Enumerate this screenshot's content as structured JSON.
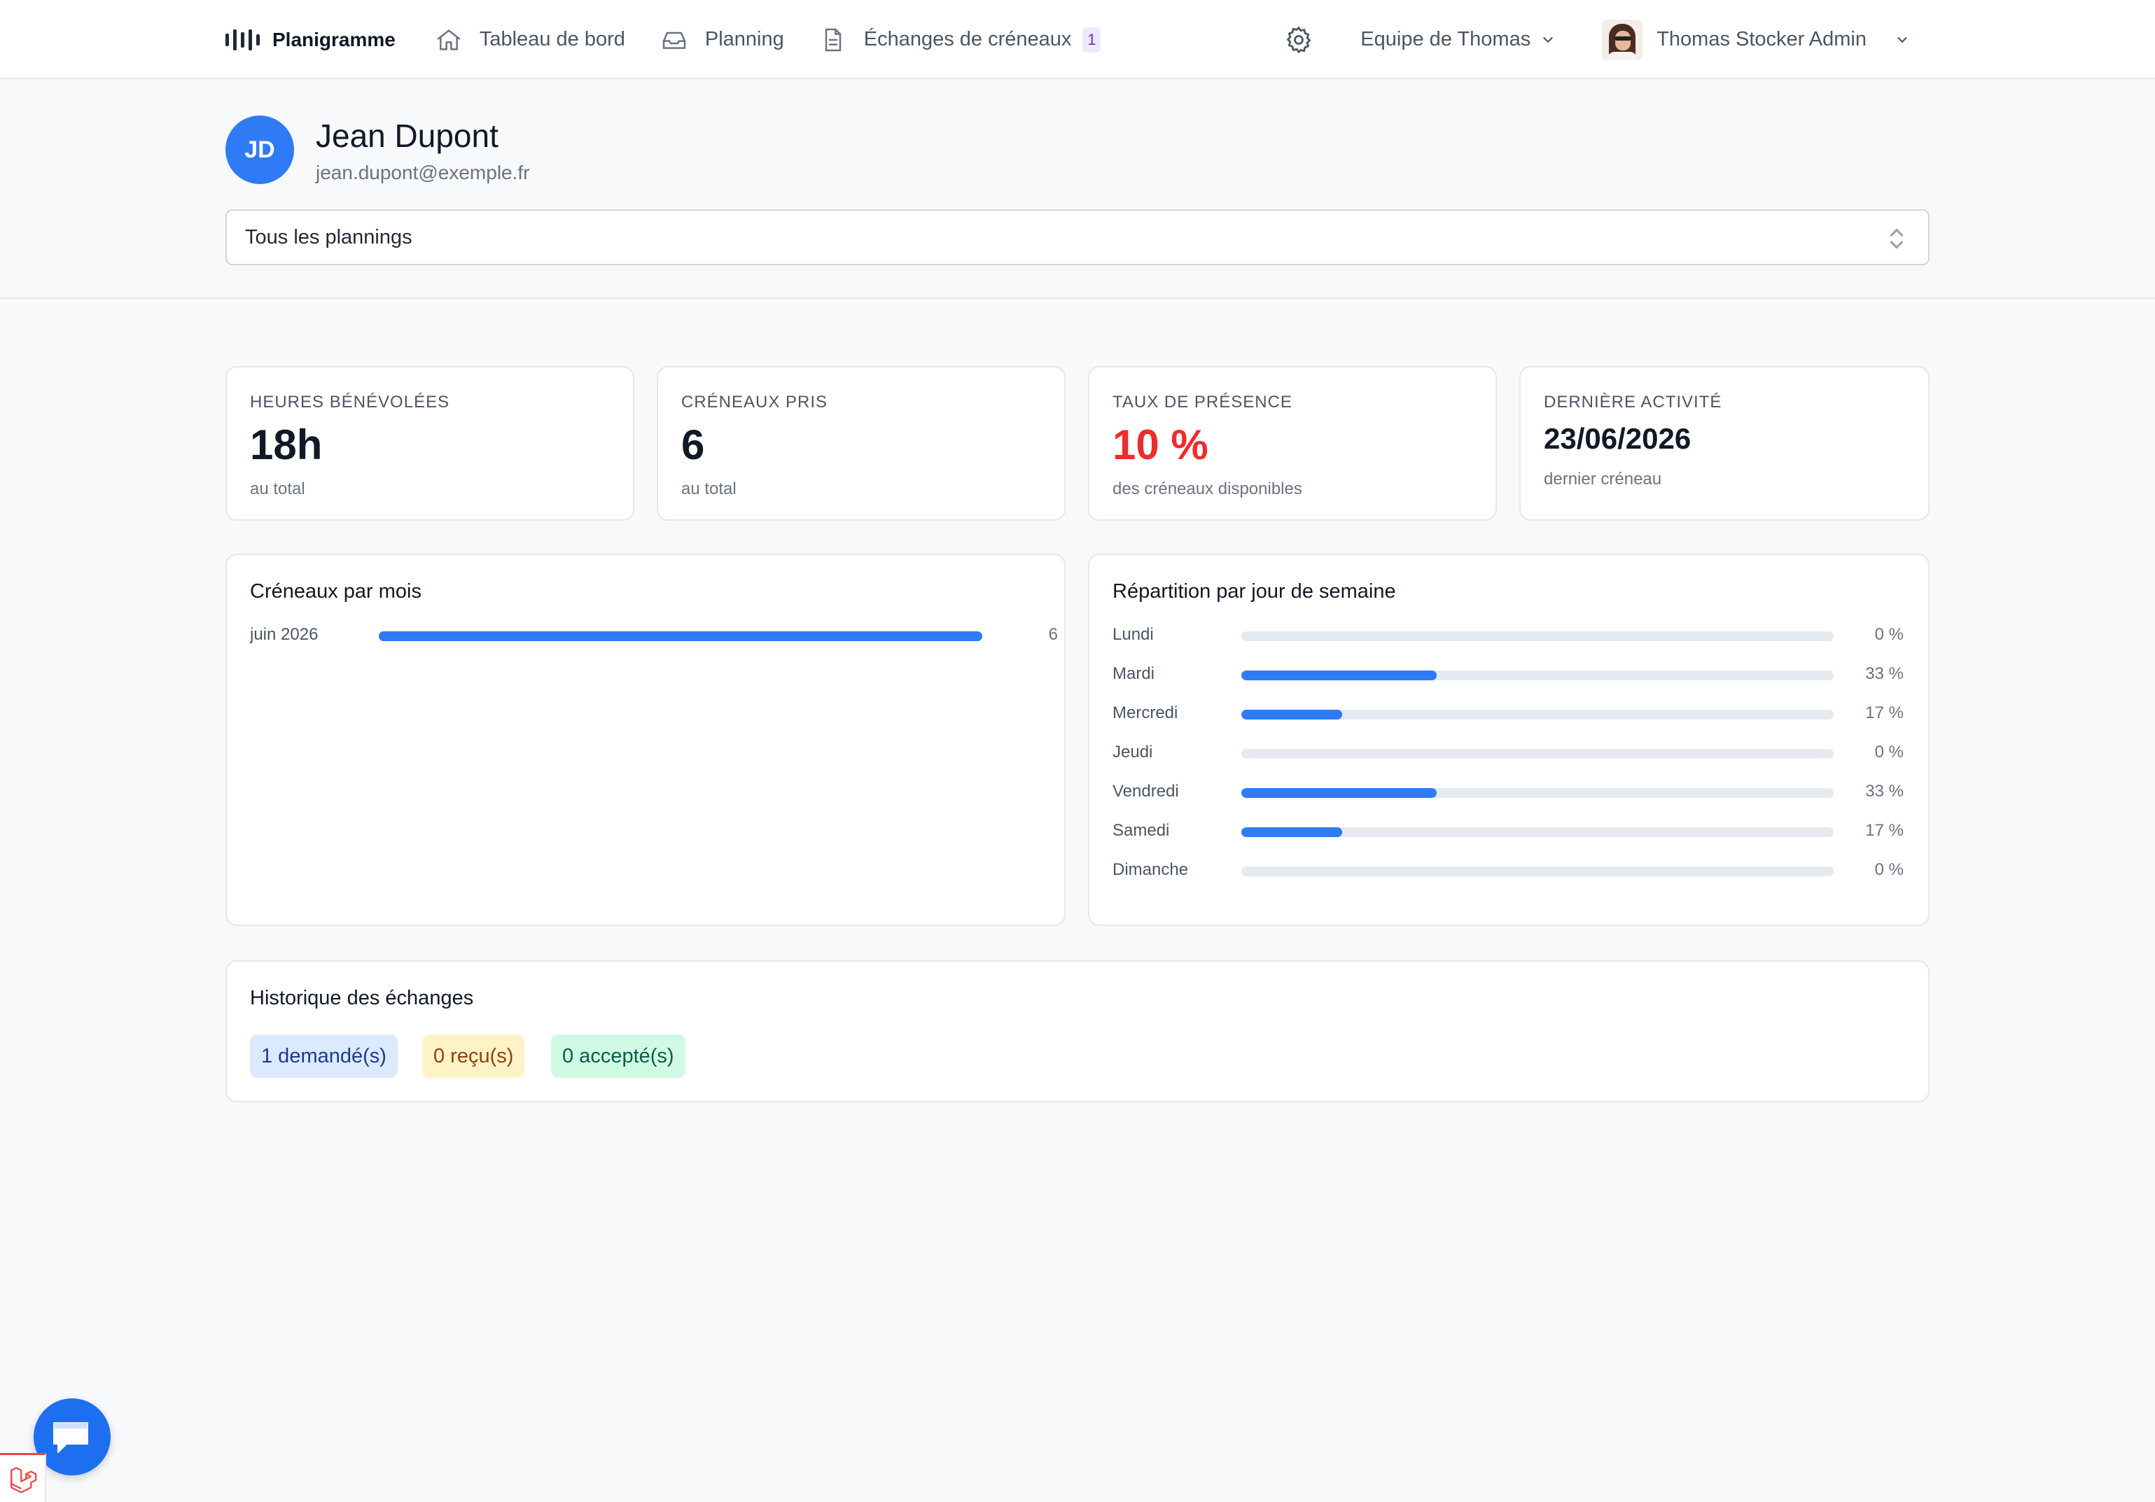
{
  "nav": {
    "brand": "Planigramme",
    "links": [
      {
        "label": "Tableau de bord",
        "icon": "home-icon"
      },
      {
        "label": "Planning",
        "icon": "inbox-icon"
      },
      {
        "label": "Échanges de créneaux",
        "icon": "document-icon",
        "badge": "1"
      }
    ],
    "team": "Equipe de Thomas",
    "user": "Thomas Stocker Admin"
  },
  "profile": {
    "initials": "JD",
    "name": "Jean Dupont",
    "email": "jean.dupont@exemple.fr",
    "planning_select": "Tous les plannings"
  },
  "stats": [
    {
      "label": "HEURES BÉNÉVOLÉES",
      "value": "18h",
      "sub": "au total"
    },
    {
      "label": "CRÉNEAUX PRIS",
      "value": "6",
      "sub": "au total"
    },
    {
      "label": "TAUX DE PRÉSENCE",
      "value": "10 %",
      "sub": "des créneaux disponibles",
      "value_color": "#ef2b2b"
    },
    {
      "label": "DERNIÈRE ACTIVITÉ",
      "value": "23/06/2026",
      "sub": "dernier créneau"
    }
  ],
  "by_month": {
    "title": "Créneaux par mois",
    "rows": [
      {
        "label": "juin 2026",
        "value": "6",
        "fill": 1.0
      }
    ]
  },
  "by_weekday": {
    "title": "Répartition par jour de semaine",
    "rows": [
      {
        "label": "Lundi",
        "value": "0 %",
        "fill": 0.0
      },
      {
        "label": "Mardi",
        "value": "33 %",
        "fill": 0.33
      },
      {
        "label": "Mercredi",
        "value": "17 %",
        "fill": 0.17
      },
      {
        "label": "Jeudi",
        "value": "0 %",
        "fill": 0.0
      },
      {
        "label": "Vendredi",
        "value": "33 %",
        "fill": 0.33
      },
      {
        "label": "Samedi",
        "value": "17 %",
        "fill": 0.17
      },
      {
        "label": "Dimanche",
        "value": "0 %",
        "fill": 0.0
      }
    ]
  },
  "history": {
    "title": "Historique des échanges",
    "requested": "1 demandé(s)",
    "received": "0 reçu(s)",
    "accepted": "0 accepté(s)"
  },
  "colors": {
    "accent": "#2f7bf5",
    "danger": "#ef2b2b",
    "track": "#e5e9f0"
  }
}
